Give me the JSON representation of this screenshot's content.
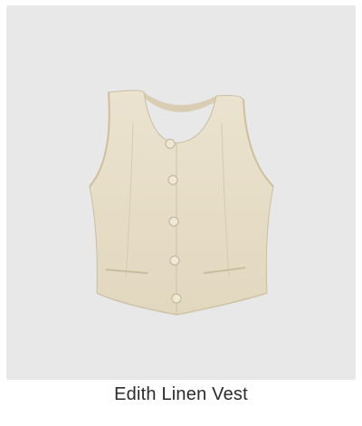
{
  "product": {
    "name": "Edith Linen Vest",
    "image_icon": "linen-vest-image",
    "image_background": "#e8e8e8",
    "fabric_color": "#e6dcc6",
    "button_count": 5
  }
}
